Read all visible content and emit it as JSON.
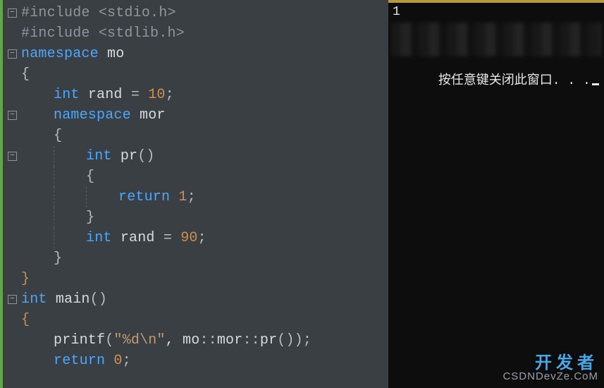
{
  "editor": {
    "lines": [
      {
        "tokens": [
          {
            "t": "#include ",
            "c": "pp"
          },
          {
            "t": "<stdio.h>",
            "c": "inc"
          }
        ],
        "indent": 0,
        "fold": true
      },
      {
        "tokens": [
          {
            "t": "#include ",
            "c": "pp"
          },
          {
            "t": "<stdlib.h>",
            "c": "inc"
          }
        ],
        "indent": 0
      },
      {
        "tokens": [
          {
            "t": "namespace ",
            "c": "kw"
          },
          {
            "t": "mo",
            "c": "nm"
          }
        ],
        "indent": 0,
        "fold": true
      },
      {
        "tokens": [
          {
            "t": "{",
            "c": "br"
          }
        ],
        "indent": 0
      },
      {
        "tokens": [
          {
            "t": "int ",
            "c": "ty"
          },
          {
            "t": "rand ",
            "c": "id"
          },
          {
            "t": "= ",
            "c": "punc"
          },
          {
            "t": "10",
            "c": "num"
          },
          {
            "t": ";",
            "c": "punc"
          }
        ],
        "indent": 1
      },
      {
        "tokens": [
          {
            "t": "namespace ",
            "c": "kw"
          },
          {
            "t": "mor",
            "c": "nm"
          }
        ],
        "indent": 1,
        "fold": true
      },
      {
        "tokens": [
          {
            "t": "{",
            "c": "br"
          }
        ],
        "indent": 1
      },
      {
        "tokens": [
          {
            "t": "int ",
            "c": "ty"
          },
          {
            "t": "pr",
            "c": "fn"
          },
          {
            "t": "()",
            "c": "punc"
          }
        ],
        "indent": 2,
        "fold": true
      },
      {
        "tokens": [
          {
            "t": "{",
            "c": "br"
          }
        ],
        "indent": 2
      },
      {
        "tokens": [
          {
            "t": "return ",
            "c": "kw"
          },
          {
            "t": "1",
            "c": "num"
          },
          {
            "t": ";",
            "c": "punc"
          }
        ],
        "indent": 3
      },
      {
        "tokens": [
          {
            "t": "}",
            "c": "br"
          }
        ],
        "indent": 2
      },
      {
        "tokens": [
          {
            "t": "int ",
            "c": "ty"
          },
          {
            "t": "rand ",
            "c": "id"
          },
          {
            "t": "= ",
            "c": "punc"
          },
          {
            "t": "90",
            "c": "num"
          },
          {
            "t": ";",
            "c": "punc"
          }
        ],
        "indent": 2
      },
      {
        "tokens": [
          {
            "t": "}",
            "c": "br"
          }
        ],
        "indent": 1
      },
      {
        "tokens": [
          {
            "t": "}",
            "c": "brp"
          }
        ],
        "indent": 0
      },
      {
        "tokens": [
          {
            "t": "int ",
            "c": "ty"
          },
          {
            "t": "main",
            "c": "fn"
          },
          {
            "t": "()",
            "c": "punc"
          }
        ],
        "indent": 0,
        "fold": true
      },
      {
        "tokens": [
          {
            "t": "{",
            "c": "brp"
          }
        ],
        "indent": 0
      },
      {
        "tokens": [
          {
            "t": "printf",
            "c": "fn"
          },
          {
            "t": "(",
            "c": "punc"
          },
          {
            "t": "\"%d\\n\"",
            "c": "str"
          },
          {
            "t": ", mo",
            "c": "id"
          },
          {
            "t": "::",
            "c": "punc"
          },
          {
            "t": "mor",
            "c": "id"
          },
          {
            "t": "::",
            "c": "punc"
          },
          {
            "t": "pr",
            "c": "fn"
          },
          {
            "t": "())",
            "c": "punc"
          },
          {
            "t": ";",
            "c": "punc"
          }
        ],
        "indent": 1
      },
      {
        "tokens": [
          {
            "t": "return ",
            "c": "kw"
          },
          {
            "t": "0",
            "c": "num"
          },
          {
            "t": ";",
            "c": "punc"
          }
        ],
        "indent": 1
      }
    ]
  },
  "console": {
    "output_value": "1",
    "prompt_text": "按任意键关闭此窗口. . ."
  },
  "watermark": {
    "line1": "开发者",
    "line2": "CSDNDevZe.CoM"
  }
}
